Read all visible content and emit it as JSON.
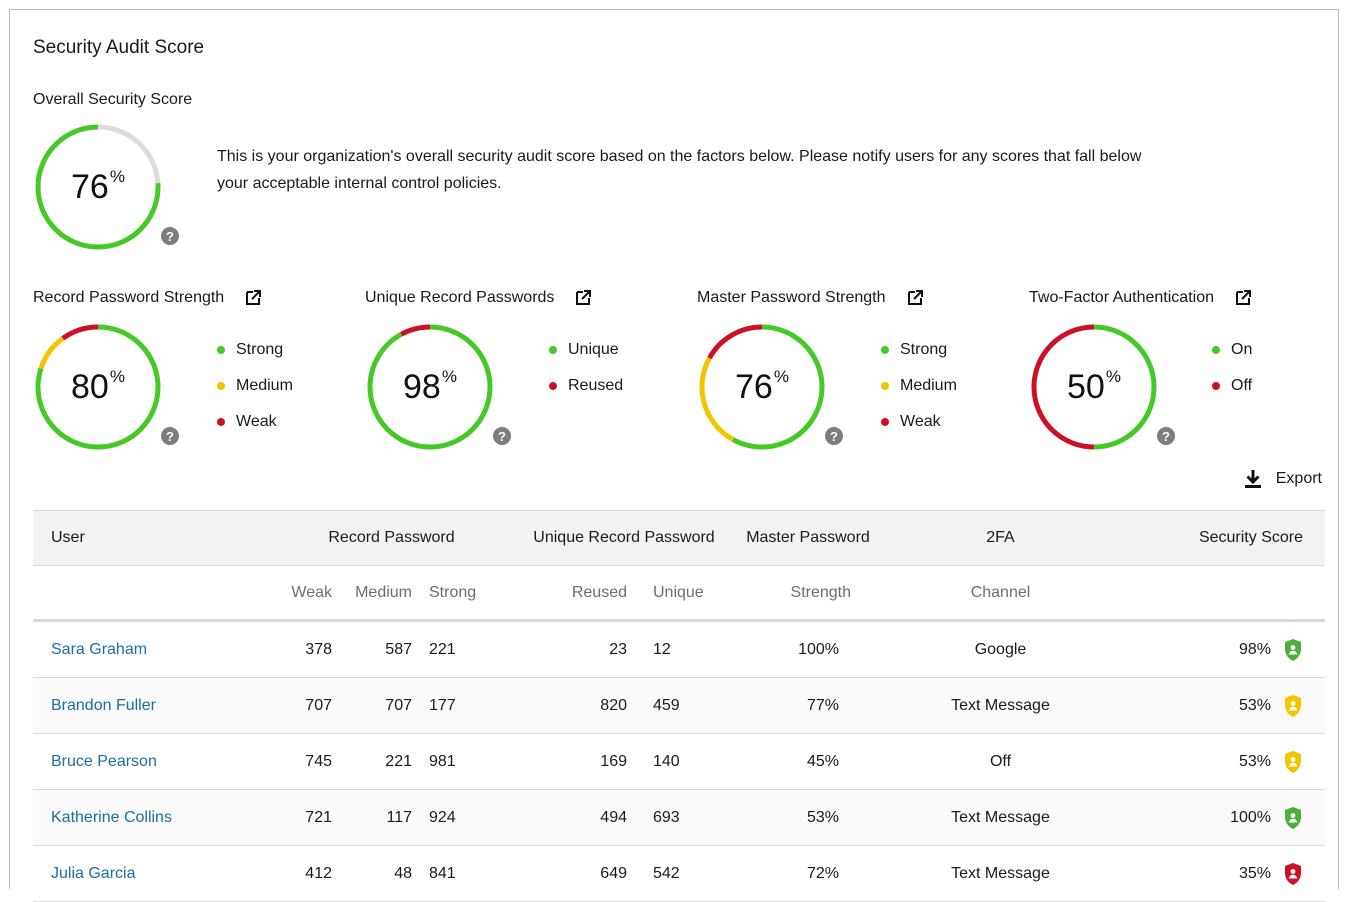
{
  "page": {
    "title": "Security Audit Score",
    "overall_label": "Overall Security Score",
    "description": "This is your organization's overall security audit score based on the factors below. Please notify users for any scores that fall below your acceptable internal control policies."
  },
  "overall_gauge": {
    "value": "76",
    "unit": "%",
    "segments": [
      {
        "color": "#44c926",
        "fraction": 0.76
      },
      {
        "color": "#dcdcdc",
        "fraction": 0.24
      }
    ]
  },
  "cards": [
    {
      "title": "Record Password Strength",
      "value": "80",
      "unit": "%",
      "segments": [
        {
          "color": "#44c926",
          "fraction": 0.8
        },
        {
          "color": "#f5c400",
          "fraction": 0.1
        },
        {
          "color": "#cc1126",
          "fraction": 0.1
        }
      ],
      "legend": [
        {
          "label": "Strong",
          "color": "#44c926"
        },
        {
          "label": "Medium",
          "color": "#f5c400"
        },
        {
          "label": "Weak",
          "color": "#cc1126"
        }
      ]
    },
    {
      "title": "Unique Record Passwords",
      "value": "98",
      "unit": "%",
      "segments": [
        {
          "color": "#44c926",
          "fraction": 0.92
        },
        {
          "color": "#cc1126",
          "fraction": 0.08
        }
      ],
      "legend": [
        {
          "label": "Unique",
          "color": "#44c926"
        },
        {
          "label": "Reused",
          "color": "#cc1126"
        }
      ]
    },
    {
      "title": "Master Password Strength",
      "value": "76",
      "unit": "%",
      "segments": [
        {
          "color": "#44c926",
          "fraction": 0.58
        },
        {
          "color": "#f5c400",
          "fraction": 0.25
        },
        {
          "color": "#cc1126",
          "fraction": 0.17
        }
      ],
      "legend": [
        {
          "label": "Strong",
          "color": "#44c926"
        },
        {
          "label": "Medium",
          "color": "#f5c400"
        },
        {
          "label": "Weak",
          "color": "#cc1126"
        }
      ]
    },
    {
      "title": "Two-Factor Authentication",
      "value": "50",
      "unit": "%",
      "segments": [
        {
          "color": "#44c926",
          "fraction": 0.5
        },
        {
          "color": "#cc1126",
          "fraction": 0.5
        }
      ],
      "legend": [
        {
          "label": "On",
          "color": "#44c926"
        },
        {
          "label": "Off",
          "color": "#cc1126"
        }
      ]
    }
  ],
  "export_label": "Export",
  "help_glyph": "?",
  "table": {
    "group_headers": [
      "User",
      "Record Password",
      "Unique Record Password",
      "Master Password",
      "2FA",
      "Security Score"
    ],
    "sub_headers": [
      "Weak",
      "Medium",
      "Strong",
      "Reused",
      "Unique",
      "Strength",
      "Channel"
    ],
    "rows": [
      {
        "user": "Sara Graham",
        "weak": "378",
        "medium": "587",
        "strong": "221",
        "reused": "23",
        "unique": "12",
        "strength": "100%",
        "channel": "Google",
        "score": "98%",
        "shield_color": "#4caf3a"
      },
      {
        "user": "Brandon Fuller",
        "weak": "707",
        "medium": "707",
        "strong": "177",
        "reused": "820",
        "unique": "459",
        "strength": "77%",
        "channel": "Text Message",
        "score": "53%",
        "shield_color": "#f5c400"
      },
      {
        "user": "Bruce Pearson",
        "weak": "745",
        "medium": "221",
        "strong": "981",
        "reused": "169",
        "unique": "140",
        "strength": "45%",
        "channel": "Off",
        "score": "53%",
        "shield_color": "#f5c400"
      },
      {
        "user": "Katherine Collins",
        "weak": "721",
        "medium": "117",
        "strong": "924",
        "reused": "494",
        "unique": "693",
        "strength": "53%",
        "channel": "Text Message",
        "score": "100%",
        "shield_color": "#4caf3a"
      },
      {
        "user": "Julia Garcia",
        "weak": "412",
        "medium": "48",
        "strong": "841",
        "reused": "649",
        "unique": "542",
        "strength": "72%",
        "channel": "Text Message",
        "score": "35%",
        "shield_color": "#cc1126"
      }
    ]
  }
}
